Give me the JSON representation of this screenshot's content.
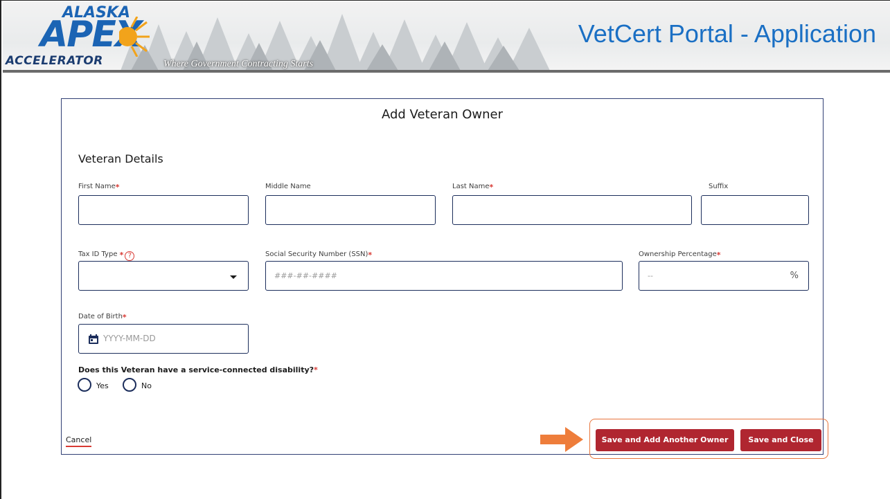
{
  "header": {
    "logo_alaska": "ALASKA",
    "logo_apex": "APEX",
    "logo_accelerator": "ACCELERATOR",
    "tagline": "Where Government Contracting Starts",
    "title": "VetCert Portal - Application"
  },
  "modal": {
    "title": "Add Veteran Owner",
    "section_title": "Veteran Details",
    "fields": {
      "first_name": {
        "label": "First Name",
        "required": "*",
        "value": ""
      },
      "middle_name": {
        "label": "Middle Name",
        "value": ""
      },
      "last_name": {
        "label": "Last Name",
        "required": "*",
        "value": ""
      },
      "suffix": {
        "label": "Suffix",
        "value": ""
      },
      "tax_id_type": {
        "label": "Tax ID Type",
        "required": "*",
        "help_icon": "question-circle-icon",
        "value": ""
      },
      "ssn": {
        "label": "Social Security Number (SSN)",
        "required": "*",
        "placeholder": "###-##-####"
      },
      "ownership": {
        "label": "Ownership Percentage",
        "required": "*",
        "placeholder": "--",
        "unit": "%"
      },
      "dob": {
        "label": "Date of Birth",
        "required": "*",
        "placeholder": "YYYY-MM-DD",
        "icon": "calendar-icon"
      }
    },
    "disability_question": {
      "label": "Does this Veteran have a service-connected disability?",
      "required": "*",
      "options": [
        "Yes",
        "No"
      ]
    },
    "cancel_label": "Cancel",
    "save_add_label": "Save and Add Another Owner",
    "save_close_label": "Save and Close"
  },
  "colors": {
    "accent_blue": "#1a6fc4",
    "primary_button": "#b02630",
    "required_star": "#d83933",
    "highlight_orange": "#e8743b"
  }
}
